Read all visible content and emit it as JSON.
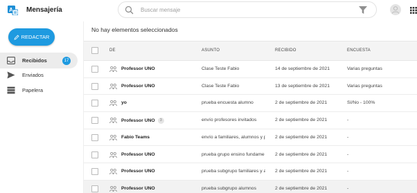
{
  "app": {
    "title": "Mensajería"
  },
  "search": {
    "placeholder": "Buscar mensaje",
    "value": ""
  },
  "sidebar": {
    "compose_label": "REDACTAR",
    "items": [
      {
        "label": "Recibidos",
        "badge": "17",
        "icon": "inbox-icon",
        "active": true
      },
      {
        "label": "Enviados",
        "icon": "send-icon"
      },
      {
        "label": "Papelera",
        "icon": "trash-icon"
      }
    ]
  },
  "main": {
    "selection_status": "No hay elementos seleccionados",
    "columns": {
      "from": "DE",
      "subject": "ASUNTO",
      "received": "RECIBIDO",
      "survey": "ENCUESTA"
    },
    "rows": [
      {
        "from": "Professor UNO",
        "count": "",
        "subject": "Clase Teste Fabio",
        "received": "14 de septiembre de 2021",
        "survey": "Varias preguntas"
      },
      {
        "from": "Professor UNO",
        "count": "",
        "subject": "Clase Teste Fabio",
        "received": "13 de septiembre de 2021",
        "survey": "Varias preguntas"
      },
      {
        "from": "yo",
        "count": "",
        "subject": "prueba encuesta alumno",
        "received": "2 de septiembre de 2021",
        "survey": "Sí/No - 100%"
      },
      {
        "from": "Professor UNO",
        "count": "3",
        "subject": "envío profesores invitados",
        "received": "2 de septiembre de 2021",
        "survey": "-"
      },
      {
        "from": "Fabio Teams",
        "count": "",
        "subject": "envío a familiares, alumnos y p",
        "received": "2 de septiembre de 2021",
        "survey": "-"
      },
      {
        "from": "Professor UNO",
        "count": "",
        "subject": "prueba grupo ensino fundame",
        "received": "2 de septiembre de 2021",
        "survey": "-"
      },
      {
        "from": "Professor UNO",
        "count": "",
        "subject": "prueba subgrupo familiares y a",
        "received": "2 de septiembre de 2021",
        "survey": "-"
      },
      {
        "from": "Professor UNO",
        "count": "",
        "subject": "prueba subgrupo alumnos",
        "received": "2 de septiembre de 2021",
        "survey": "-"
      }
    ]
  },
  "colors": {
    "accent": "#1e9ae0",
    "active_nav": "#ececec",
    "header_row": "#f4f4f4"
  }
}
